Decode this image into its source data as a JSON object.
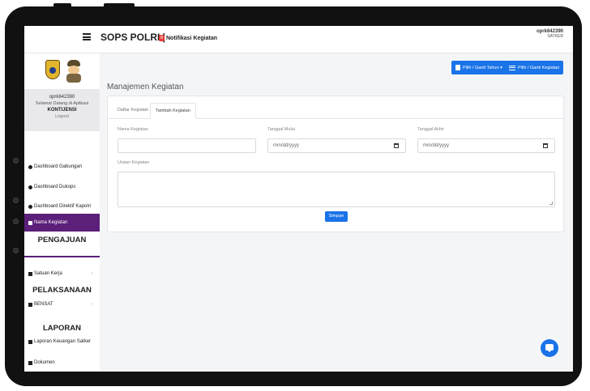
{
  "app": {
    "title": "SOPS POLRI |",
    "notification_badge": "0",
    "notification_label": "Notifikasi Kegiatan"
  },
  "user": {
    "name": "oprk642390",
    "role": "SATKER"
  },
  "profile": {
    "username": "oprk642390",
    "welcome": "Selamat Datang di Aplikasi",
    "org": "KONTIJENSI",
    "logout": "Logout"
  },
  "actions": {
    "pick_year": "Pilih / Ganti Tahun ▾",
    "pick_activity": "Pilih / Ganti Kegiatan"
  },
  "sidebar": {
    "items": [
      {
        "label": "Dashboard Gabungan"
      },
      {
        "label": "Dashboard Dukops"
      },
      {
        "label": "Dashboard Direktif Kapolri"
      },
      {
        "label": "Nama Kegiatan"
      }
    ],
    "sections": [
      {
        "title": "PENGAJUAN"
      },
      {
        "title": "PELAKSANAAN"
      },
      {
        "title": "LAPORAN"
      }
    ],
    "satuan_kerja": "Satuan Kerja",
    "bensat": "BENSAT",
    "laporan_keuangan": "Laporan Keuangan Satker",
    "dokumen": "Dokumen"
  },
  "page": {
    "title": "Manajemen Kegiatan"
  },
  "tabs": [
    {
      "label": "Daftar Kegiatan"
    },
    {
      "label": "Tambah Kegiatan"
    }
  ],
  "form": {
    "nama_label": "Nama Kegiatan",
    "mulai_label": "Tanggal Mulai",
    "mulai_placeholder": "mm/dd/yyyy",
    "akhir_label": "Tanggal Akhir",
    "akhir_placeholder": "mm/dd/yyyy",
    "uraian_label": "Uraian Kegiatan",
    "save_label": "Simpan"
  }
}
